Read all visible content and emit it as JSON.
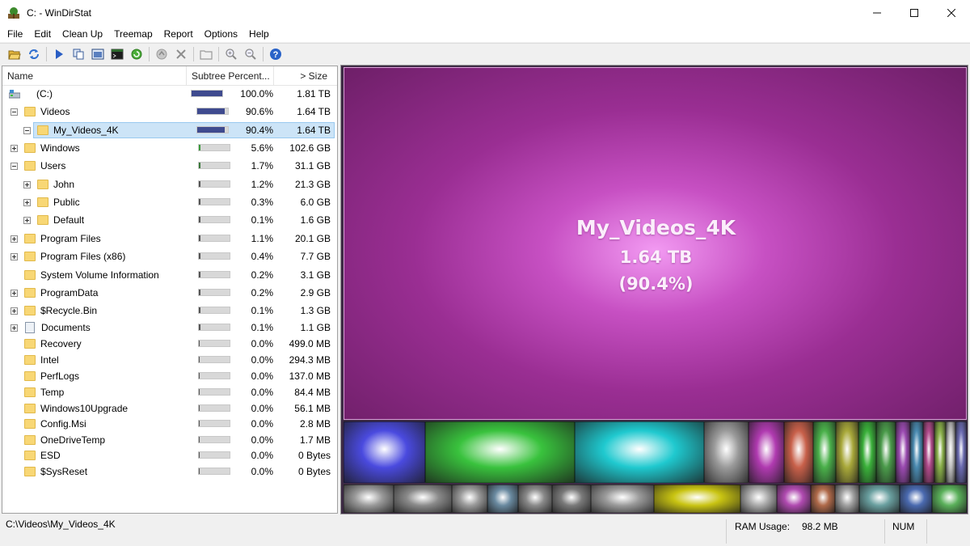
{
  "window": {
    "title": "C: - WinDirStat",
    "minimize_glyph": "—",
    "maximize_glyph": "☐",
    "close_glyph": "✕"
  },
  "menu": [
    "File",
    "Edit",
    "Clean Up",
    "Treemap",
    "Report",
    "Options",
    "Help"
  ],
  "toolbar": {
    "icons": [
      "open-folder-icon",
      "refresh-icon",
      "play-icon",
      "copy-icon",
      "explorer-icon",
      "command-prompt-icon",
      "refresh-selected-icon",
      "recycle-icon",
      "delete-icon",
      "properties-icon",
      "zoom-in-icon",
      "zoom-out-icon",
      "help-icon"
    ]
  },
  "columns": {
    "name": "Name",
    "subtree": "Subtree Percent...",
    "size": "> Size"
  },
  "tree_rows": [
    {
      "name": "(C:)",
      "pct": "100.0%",
      "size": "1.81 TB",
      "fraction": 1.0,
      "level": 0,
      "expander": "none",
      "icon": "drive",
      "bar_color": "#3f4b8f"
    },
    {
      "name": "Videos",
      "pct": "90.6%",
      "size": "1.64 TB",
      "fraction": 0.906,
      "level": 1,
      "expander": "minus",
      "icon": "folder",
      "bar_color": "#3f4b8f"
    },
    {
      "name": "My_Videos_4K",
      "pct": "90.4%",
      "size": "1.64 TB",
      "fraction": 0.904,
      "level": 2,
      "expander": "minus",
      "icon": "folder",
      "bar_color": "#3f4b8f",
      "selected": true
    },
    {
      "name": "Windows",
      "pct": "5.6%",
      "size": "102.6 GB",
      "fraction": 0.056,
      "level": 1,
      "expander": "plus",
      "icon": "folder",
      "bar_color": "#3b9a3b"
    },
    {
      "name": "Users",
      "pct": "1.7%",
      "size": "31.1 GB",
      "fraction": 0.017,
      "level": 1,
      "expander": "minus",
      "icon": "folder",
      "bar_color": "#3b7a3b"
    },
    {
      "name": "John",
      "pct": "1.2%",
      "size": "21.3 GB",
      "fraction": 0.012,
      "level": 2,
      "expander": "plus",
      "icon": "folder",
      "bar_color": "#555"
    },
    {
      "name": "Public",
      "pct": "0.3%",
      "size": "6.0 GB",
      "fraction": 0.003,
      "level": 2,
      "expander": "plus",
      "icon": "folder",
      "bar_color": "#555"
    },
    {
      "name": "Default",
      "pct": "0.1%",
      "size": "1.6 GB",
      "fraction": 0.001,
      "level": 2,
      "expander": "plus",
      "icon": "folder",
      "bar_color": "#555"
    },
    {
      "name": "Program Files",
      "pct": "1.1%",
      "size": "20.1 GB",
      "fraction": 0.011,
      "level": 1,
      "expander": "plus",
      "icon": "folder",
      "bar_color": "#555"
    },
    {
      "name": "Program Files (x86)",
      "pct": "0.4%",
      "size": "7.7 GB",
      "fraction": 0.004,
      "level": 1,
      "expander": "plus",
      "icon": "folder",
      "bar_color": "#555"
    },
    {
      "name": "System Volume Information",
      "pct": "0.2%",
      "size": "3.1 GB",
      "fraction": 0.002,
      "level": 1,
      "expander": "none",
      "icon": "folder",
      "bar_color": "#555"
    },
    {
      "name": "ProgramData",
      "pct": "0.2%",
      "size": "2.9 GB",
      "fraction": 0.002,
      "level": 1,
      "expander": "plus",
      "icon": "folder",
      "bar_color": "#555"
    },
    {
      "name": "$Recycle.Bin",
      "pct": "0.1%",
      "size": "1.3 GB",
      "fraction": 0.001,
      "level": 1,
      "expander": "plus",
      "icon": "folder",
      "bar_color": "#555"
    },
    {
      "name": "Documents",
      "pct": "0.1%",
      "size": "1.1 GB",
      "fraction": 0.001,
      "level": 1,
      "expander": "plus",
      "icon": "document",
      "bar_color": "#555"
    },
    {
      "name": "Recovery",
      "pct": "0.0%",
      "size": "499.0 MB",
      "fraction": 0.0,
      "level": 1,
      "expander": "none",
      "icon": "folder",
      "bar_color": "#555"
    },
    {
      "name": "Intel",
      "pct": "0.0%",
      "size": "294.3 MB",
      "fraction": 0.0,
      "level": 1,
      "expander": "none",
      "icon": "folder",
      "bar_color": "#555"
    },
    {
      "name": "PerfLogs",
      "pct": "0.0%",
      "size": "137.0 MB",
      "fraction": 0.0,
      "level": 1,
      "expander": "none",
      "icon": "folder",
      "bar_color": "#555"
    },
    {
      "name": "Temp",
      "pct": "0.0%",
      "size": "84.4 MB",
      "fraction": 0.0,
      "level": 1,
      "expander": "none",
      "icon": "folder",
      "bar_color": "#555"
    },
    {
      "name": "Windows10Upgrade",
      "pct": "0.0%",
      "size": "56.1 MB",
      "fraction": 0.0,
      "level": 1,
      "expander": "none",
      "icon": "folder",
      "bar_color": "#555"
    },
    {
      "name": "Config.Msi",
      "pct": "0.0%",
      "size": "2.8 MB",
      "fraction": 0.0,
      "level": 1,
      "expander": "none",
      "icon": "folder",
      "bar_color": "#555"
    },
    {
      "name": "OneDriveTemp",
      "pct": "0.0%",
      "size": "1.7 MB",
      "fraction": 0.0,
      "level": 1,
      "expander": "none",
      "icon": "folder",
      "bar_color": "#555"
    },
    {
      "name": "ESD",
      "pct": "0.0%",
      "size": "0 Bytes",
      "fraction": 0.0,
      "level": 1,
      "expander": "none",
      "icon": "folder",
      "bar_color": "#555"
    },
    {
      "name": "$SysReset",
      "pct": "0.0%",
      "size": "0 Bytes",
      "fraction": 0.0,
      "level": 1,
      "expander": "none",
      "icon": "folder",
      "bar_color": "#555"
    }
  ],
  "treemap": {
    "name": "My_Videos_4K",
    "size": "1.64 TB",
    "pct": "(90.4%)",
    "colors": {
      "main": "#a83aa3",
      "blue": "#4a4adf",
      "green": "#39c23d",
      "cyan": "#1fc9cf",
      "gray": "#9a9a9a",
      "yellow": "#c9c412"
    }
  },
  "status": {
    "path": "C:\\Videos\\My_Videos_4K",
    "ram_label": "RAM Usage:",
    "ram_value": "98.2 MB",
    "num": "NUM"
  }
}
